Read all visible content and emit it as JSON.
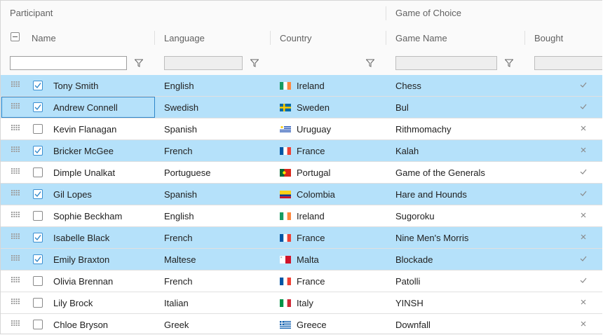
{
  "bands": {
    "participant": "Participant",
    "game_of_choice": "Game of Choice"
  },
  "columns": {
    "name": "Name",
    "language": "Language",
    "country": "Country",
    "game": "Game Name",
    "bought": "Bought"
  },
  "filter": {
    "name_value": ""
  },
  "colors": {
    "selected_row": "#b5e1fa",
    "accent": "#2e86c9"
  },
  "rows": [
    {
      "selected": true,
      "name": "Tony Smith",
      "language": "English",
      "country": "Ireland",
      "flag": "ireland",
      "game": "Chess",
      "bought": true
    },
    {
      "selected": true,
      "name": "Andrew Connell",
      "language": "Swedish",
      "country": "Sweden",
      "flag": "sweden",
      "game": "Bul",
      "bought": true,
      "focused": true
    },
    {
      "selected": false,
      "name": "Kevin Flanagan",
      "language": "Spanish",
      "country": "Uruguay",
      "flag": "uruguay",
      "game": "Rithmomachy",
      "bought": false
    },
    {
      "selected": true,
      "name": "Bricker McGee",
      "language": "French",
      "country": "France",
      "flag": "france",
      "game": "Kalah",
      "bought": false
    },
    {
      "selected": false,
      "name": "Dimple Unalkat",
      "language": "Portuguese",
      "country": "Portugal",
      "flag": "portugal",
      "game": "Game of the Generals",
      "bought": true
    },
    {
      "selected": true,
      "name": "Gil Lopes",
      "language": "Spanish",
      "country": "Colombia",
      "flag": "colombia",
      "game": "Hare and Hounds",
      "bought": true
    },
    {
      "selected": false,
      "name": "Sophie Beckham",
      "language": "English",
      "country": "Ireland",
      "flag": "ireland",
      "game": "Sugoroku",
      "bought": false
    },
    {
      "selected": true,
      "name": "Isabelle Black",
      "language": "French",
      "country": "France",
      "flag": "france",
      "game": "Nine Men's Morris",
      "bought": false
    },
    {
      "selected": true,
      "name": "Emily Braxton",
      "language": "Maltese",
      "country": "Malta",
      "flag": "malta",
      "game": "Blockade",
      "bought": true
    },
    {
      "selected": false,
      "name": "Olivia Brennan",
      "language": "French",
      "country": "France",
      "flag": "france",
      "game": "Patolli",
      "bought": true
    },
    {
      "selected": false,
      "name": "Lily Brock",
      "language": "Italian",
      "country": "Italy",
      "flag": "italy",
      "game": "YINSH",
      "bought": false
    },
    {
      "selected": false,
      "name": "Chloe Bryson",
      "language": "Greek",
      "country": "Greece",
      "flag": "greece",
      "game": "Downfall",
      "bought": false
    }
  ]
}
